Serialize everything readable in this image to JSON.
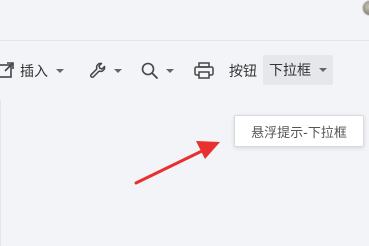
{
  "toolbar": {
    "insert_label": "插入",
    "button_label": "按钮",
    "dropdown_label": "下拉框"
  },
  "tooltip": {
    "text": "悬浮提示-下拉框"
  },
  "icons": {
    "insert": "insert-icon",
    "tools": "wrench-icon",
    "search": "search-icon",
    "print": "print-icon",
    "avatar": "avatar"
  },
  "colors": {
    "background": "#f3f4f7",
    "annotation_arrow": "#e8302e",
    "dropdown_bg": "#e6e7eb"
  }
}
